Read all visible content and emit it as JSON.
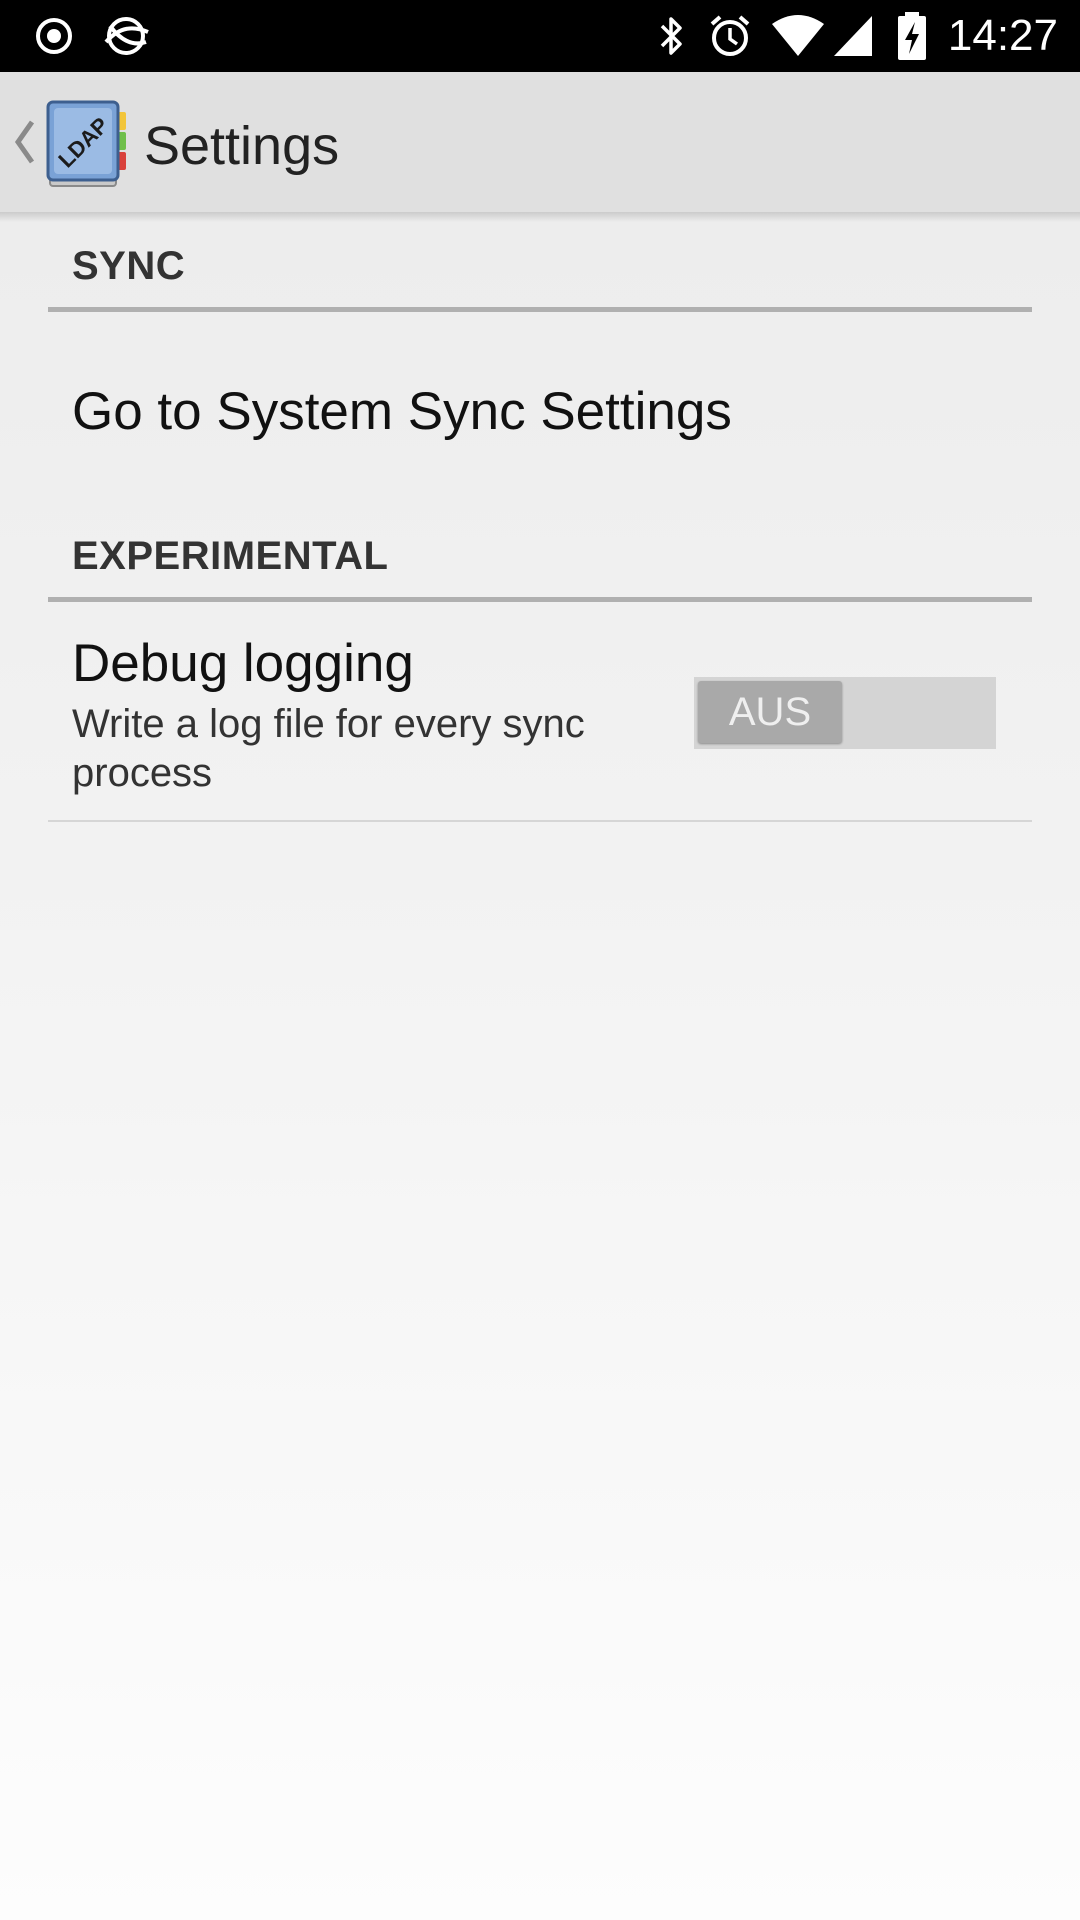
{
  "status_bar": {
    "time": "14:27",
    "left_icons": [
      "record-icon",
      "sync-globe-icon"
    ],
    "right_icons": [
      "bluetooth-icon",
      "alarm-icon",
      "wifi-icon",
      "cell-signal-icon",
      "battery-charging-icon"
    ]
  },
  "action_bar": {
    "title": "Settings",
    "app_icon": "ldap-book-icon",
    "app_icon_text": "LDAP"
  },
  "preferences": {
    "sync": {
      "category_title": "SYNC",
      "system_sync_title": "Go to System Sync Settings"
    },
    "experimental": {
      "category_title": "EXPERIMENTAL",
      "debug_logging": {
        "title": "Debug logging",
        "summary": "Write a log file for every sync process",
        "toggle_label": "AUS",
        "enabled": false
      }
    }
  },
  "colors": {
    "status_bar_bg": "#000000",
    "action_bar_bg": "#e0e0e0",
    "category_divider": "#b0b0b0",
    "toggle_track": "#d4d4d4",
    "toggle_thumb": "#a9a9a9"
  }
}
